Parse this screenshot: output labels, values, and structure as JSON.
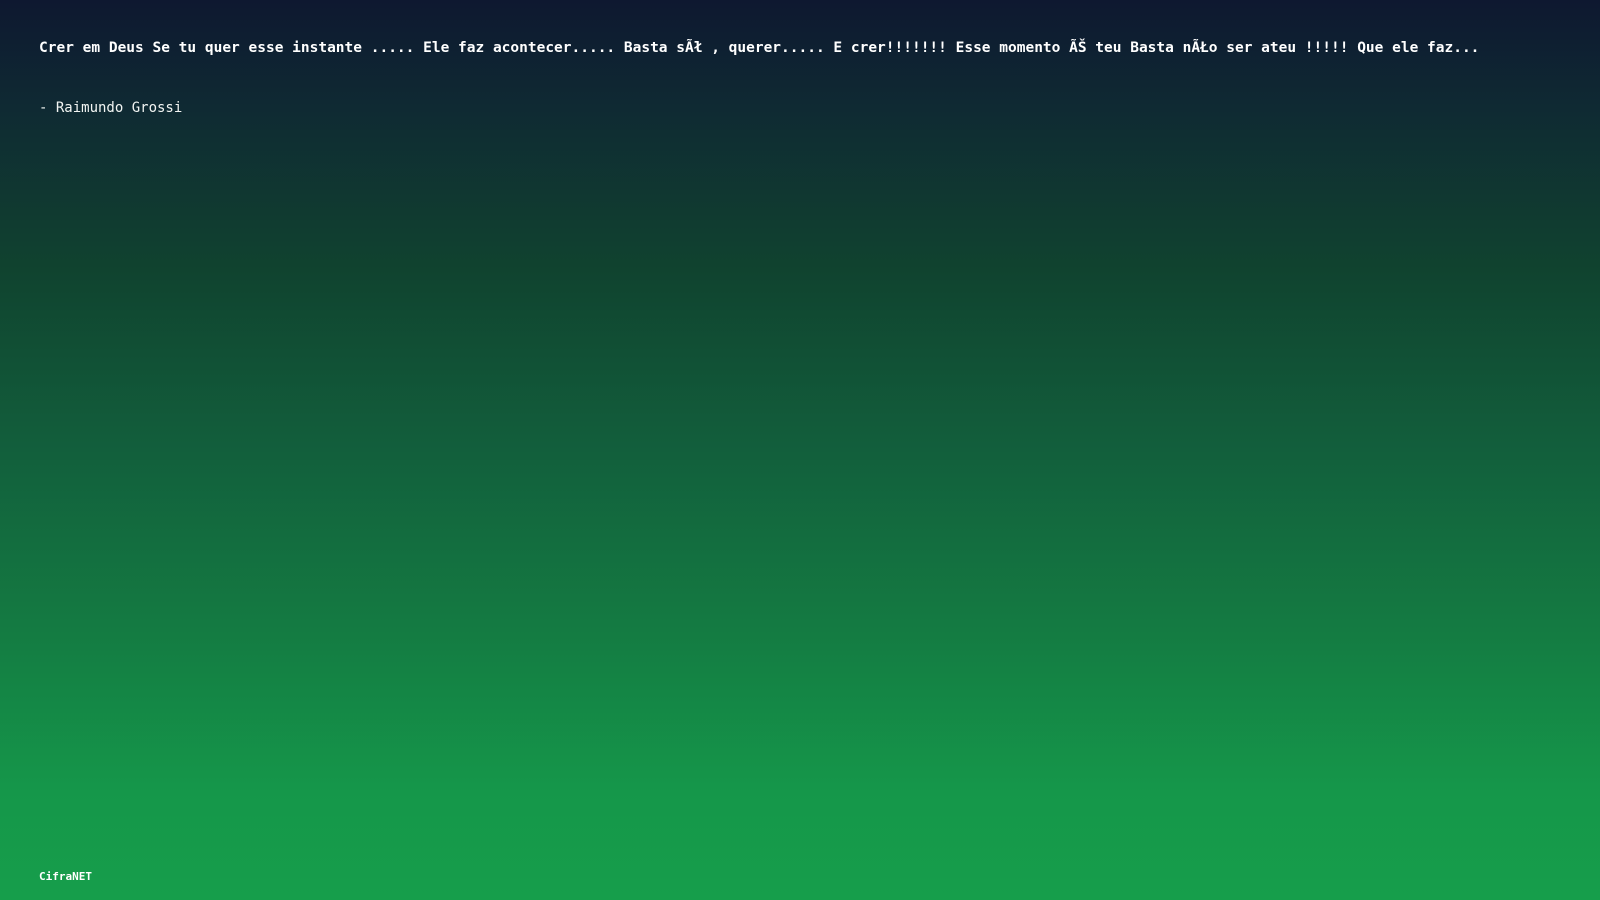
{
  "quote": {
    "text": "Crer em Deus Se tu quer esse instante ..... Ele faz acontecer..... Basta sÃł , querer..... E crer!!!!!!! Esse momento ÃŠ teu Basta nÃŁo ser ateu !!!!! Que ele faz...",
    "author": "- Raimundo Grossi"
  },
  "footer": {
    "brand": "CifraNET"
  },
  "colors": {
    "gradient_top": "#0e1830",
    "gradient_bottom": "#169e4b",
    "text": "#ffffff"
  }
}
